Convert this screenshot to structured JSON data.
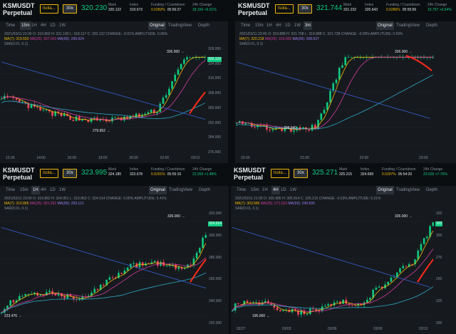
{
  "panels": [
    {
      "id": "p1",
      "symbol": "KSMUSDT",
      "sub": "Perpetual",
      "mode": "Isola...",
      "leverage": "30x",
      "last": "320.230",
      "stats": [
        {
          "k": "Mark",
          "v": "320.122",
          "c": "w"
        },
        {
          "k": "Index",
          "v": "319.673",
          "c": "w"
        },
        {
          "k": "Funding / Countdown",
          "v": "0.0282%",
          "v2": "05:56:27",
          "c": "y"
        },
        {
          "k": "24h Change",
          "v": "18.156 +6.01%",
          "c": "g"
        },
        {
          "k": "24h High",
          "v": "326.000",
          "c": "w"
        }
      ],
      "tf": [
        "Time",
        "15m",
        "1H",
        "4H",
        "1D",
        "1W"
      ],
      "tf_active": "15m",
      "views": [
        "Original",
        "TradingView",
        "Depth"
      ],
      "ohlc": "2021/03/11 23:30  O: 319.862  H: 321.190  L: 318.117  C: 320.122  CHANGE: -0.01%  AMPLITUDE: 0.96%",
      "ma": {
        "ma7": "MA(7): 319.553",
        "ma25": "MA(25): 307.015",
        "ma99": "MA(99): 299.924"
      },
      "sar": "SAR(0.01, 0.1)",
      "high_label": "326.000",
      "low_label": "279.852",
      "price_label": "320.122",
      "yticks": [
        "328.000",
        "324.000",
        "316.000",
        "308.000",
        "300.000",
        "292.000",
        "284.000",
        "276.000"
      ],
      "xticks": [
        "12:00",
        "14:00",
        "16:00",
        "18:00",
        "20:00",
        "22:00",
        "03/12"
      ]
    },
    {
      "id": "p2",
      "symbol": "KSMUSDT",
      "sub": "Perpetual",
      "mode": "Isola...",
      "leverage": "30x",
      "last": "321.744",
      "stats": [
        {
          "k": "Mark",
          "v": "321.232",
          "c": "w"
        },
        {
          "k": "Index",
          "v": "320.643",
          "c": "w"
        },
        {
          "k": "Funding / Countdown",
          "v": "0.0286%",
          "v2": "05:55:56",
          "c": "y"
        },
        {
          "k": "24h Change",
          "v": "19.757 +6.54%",
          "c": "g"
        }
      ],
      "tf": [
        "Time",
        "15m",
        "1H",
        "4H",
        "1D",
        "1W",
        "3m"
      ],
      "tf_active": "3m",
      "views": [
        "Original",
        "TradingView",
        "Depth"
      ],
      "ohlc": "2021/03/11 23:45  O: 319.888  H: 321.758  L: 319.888  C: 321.738  CHANGE: -0.00%  AMPLITUDE: 0.59%",
      "ma": {
        "ma7": "MA(7): 320.218",
        "ma25": "MA(25): 315.009",
        "ma99": "MA(99): 308.637"
      },
      "sar": "SAR(0.01, 0.1)",
      "high_label": "326.000",
      "low_label": "298.040",
      "price_label": "",
      "yticks": [
        "",
        ""
      ],
      "xticks": [
        "20:00",
        "21:00",
        "22:00",
        "23:00"
      ]
    },
    {
      "id": "p3",
      "symbol": "KSMUSDT",
      "sub": "Perpetual",
      "mode": "Isola...",
      "leverage": "30x",
      "last": "323.995",
      "stats": [
        {
          "k": "Mark",
          "v": "324.180",
          "c": "w"
        },
        {
          "k": "Index",
          "v": "323.678",
          "c": "w"
        },
        {
          "k": "Funding / Countdown",
          "v": "0.0291%",
          "v2": "05:55:16",
          "c": "y"
        },
        {
          "k": "24h Change",
          "v": "22.559 +1.48%",
          "c": "g"
        },
        {
          "k": "24h High",
          "v": "326.000",
          "c": "w"
        }
      ],
      "tf": [
        "Time",
        "15m",
        "1H",
        "4H",
        "1D",
        "1W"
      ],
      "tf_active": "1H",
      "views": [
        "Original",
        "TradingView",
        "Depth"
      ],
      "ohlc": "2021/03/11 23:00  O: 319.862  H: 324.951  L: 319.862  C: 324.014  CHANGE: 0.05%  AMPLITUDE: 5.41%",
      "ma": {
        "ma7": "MA(7): 310.865",
        "ma25": "MA(25): 301.291",
        "ma99": "MA(99): 269.121"
      },
      "sar": "SAR(0.01, 0.1)",
      "high_label": "326.000",
      "low_label": "223.476",
      "price_label": "324.014",
      "yticks": [
        "320.000",
        "300.000",
        "280.000",
        "260.000",
        "240.000",
        "220.000"
      ],
      "xticks": []
    },
    {
      "id": "p4",
      "symbol": "KSMUSDT",
      "sub": "Perpetual",
      "mode": "Isola...",
      "leverage": "30x",
      "last": "325.271",
      "stats": [
        {
          "k": "Mark",
          "v": "325.215",
          "c": "w"
        },
        {
          "k": "Index",
          "v": "324.699",
          "c": "w"
        },
        {
          "k": "Funding / Countdown",
          "v": "0.0297%",
          "v2": "05:54:20",
          "c": "y"
        },
        {
          "k": "24h Change",
          "v": "23.626 +7.76%",
          "c": "g"
        }
      ],
      "tf": [
        "Time",
        "15m",
        "1H",
        "4H",
        "1D",
        "1W"
      ],
      "tf_active": "4H",
      "views": [
        "Original",
        "TradingView",
        "Depth"
      ],
      "ohlc": "2021/03/11 21:00  O: 305.985  H: 305.814  C: 325.215  CHANGE: -0.03%  AMPLITUDE: 6.21%",
      "ma": {
        "ma7": "MA(7): 303.586",
        "ma25": "MA(25): 271.023",
        "ma99": "MA(99): 240.699"
      },
      "sar": "SAR(0.01, 0.1)",
      "high_label": "326.000",
      "low_label": "195.000",
      "price_label": "325",
      "yticks": [
        "325",
        "300",
        "275",
        "250",
        "225",
        "200"
      ],
      "xticks": [
        "02/27",
        "03/03",
        "03/06",
        "03/09",
        "03/12"
      ]
    }
  ]
}
